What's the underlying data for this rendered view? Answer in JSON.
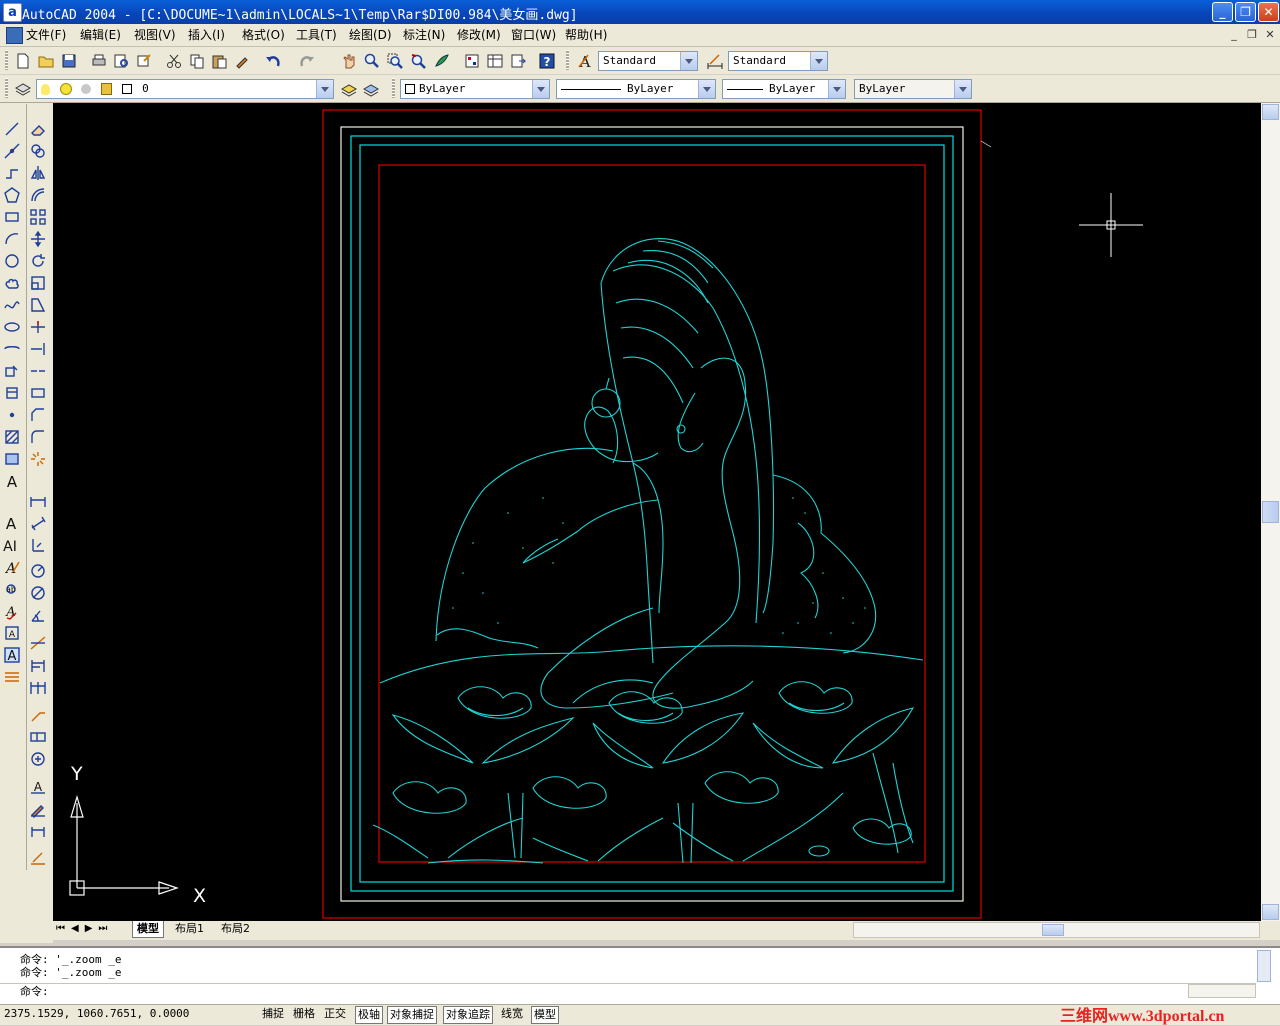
{
  "window": {
    "title": "AutoCAD 2004 - [C:\\DOCUME~1\\admin\\LOCALS~1\\Temp\\Rar$DI00.984\\美女画.dwg]",
    "app_icon_letter": "a",
    "minimize": "_",
    "restore": "❐",
    "close": "✕"
  },
  "menu": {
    "items": [
      "文件(F)",
      "编辑(E)",
      "视图(V)",
      "插入(I)",
      "格式(O)",
      "工具(T)",
      "绘图(D)",
      "标注(N)",
      "修改(M)",
      "窗口(W)",
      "帮助(H)"
    ],
    "doc_minimize": "_",
    "doc_restore": "❐",
    "doc_close": "✕"
  },
  "toolbar": {
    "text_style": "Standard",
    "dim_style": "Standard",
    "layer": "0",
    "color": "ByLayer",
    "linetype": "ByLayer",
    "lineweight": "ByLayer",
    "plotstyle": "ByLayer"
  },
  "layout_tabs": [
    "模型",
    "布局1",
    "布局2"
  ],
  "active_tab": "模型",
  "ucs": {
    "x_label": "X",
    "y_label": "Y"
  },
  "command": {
    "history": [
      "命令: '_.zoom _e",
      "命令: '_.zoom _e"
    ],
    "prompt": "命令:"
  },
  "status": {
    "coordinates": "2375.1529,  1060.7651,  0.0000",
    "toggles": [
      "捕捉",
      "栅格",
      "正交",
      "极轴",
      "对象捕捉",
      "对象追踪",
      "线宽",
      "模型"
    ],
    "watermark": "三维网www.3dportal.cn"
  },
  "colors": {
    "drawing_bg": "#000000",
    "frame_outer": "#e00000",
    "frame_white": "#f0f0e0",
    "frame_cyan": "#00e0e0",
    "figure": "#1fd3d3",
    "titlebar": "#0845b8"
  }
}
